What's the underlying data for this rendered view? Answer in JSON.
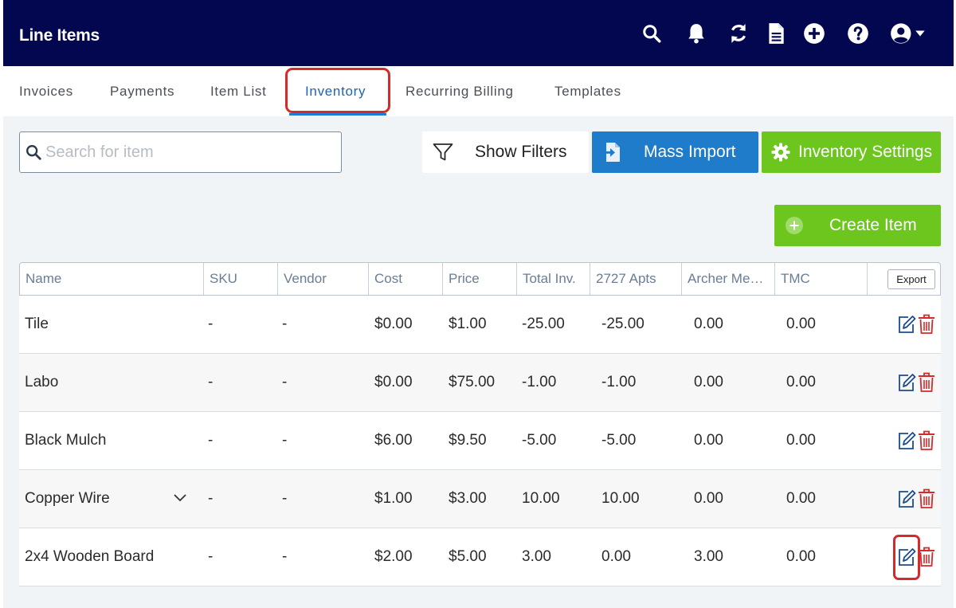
{
  "header": {
    "title": "Line Items",
    "icons": [
      "search-icon",
      "bell-icon",
      "sync-icon",
      "document-icon",
      "plus-circle-icon",
      "help-icon",
      "user-account-icon"
    ]
  },
  "tabs": [
    {
      "label": "Invoices",
      "active": false
    },
    {
      "label": "Payments",
      "active": false
    },
    {
      "label": "Item List",
      "active": false
    },
    {
      "label": "Inventory",
      "active": true
    },
    {
      "label": "Recurring Billing",
      "active": false
    },
    {
      "label": "Templates",
      "active": false
    }
  ],
  "toolbar": {
    "search_placeholder": "Search for item",
    "search_value": "",
    "filters_label": "Show Filters",
    "import_label": "Mass Import",
    "settings_label": "Inventory Settings",
    "create_label": "Create Item"
  },
  "colors": {
    "header_bg": "#02074f",
    "accent_blue": "#1e7ccb",
    "accent_green": "#6cc61e",
    "delete_red": "#d52a2a",
    "edit_blue": "#1c4c8c"
  },
  "table": {
    "columns": [
      "Name",
      "SKU",
      "Vendor",
      "Cost",
      "Price",
      "Total Inv.",
      "2727 Apts",
      "Archer Me…",
      "TMC"
    ],
    "export_label": "Export",
    "rows": [
      [
        "Tile",
        "-",
        "-",
        "$0.00",
        "$1.00",
        "-25.00",
        "-25.00",
        "0.00",
        "0.00"
      ],
      [
        "Labo",
        "-",
        "-",
        "$0.00",
        "$75.00",
        "-1.00",
        "-1.00",
        "0.00",
        "0.00"
      ],
      [
        "Black Mulch",
        "-",
        "-",
        "$6.00",
        "$9.50",
        "-5.00",
        "-5.00",
        "0.00",
        "0.00"
      ],
      [
        "Copper Wire",
        "-",
        "-",
        "$1.00",
        "$3.00",
        "10.00",
        "10.00",
        "0.00",
        "0.00"
      ],
      [
        "2x4 Wooden Board",
        "-",
        "-",
        "$2.00",
        "$5.00",
        "3.00",
        "0.00",
        "3.00",
        "0.00"
      ]
    ],
    "expandable_row_index": 3
  }
}
